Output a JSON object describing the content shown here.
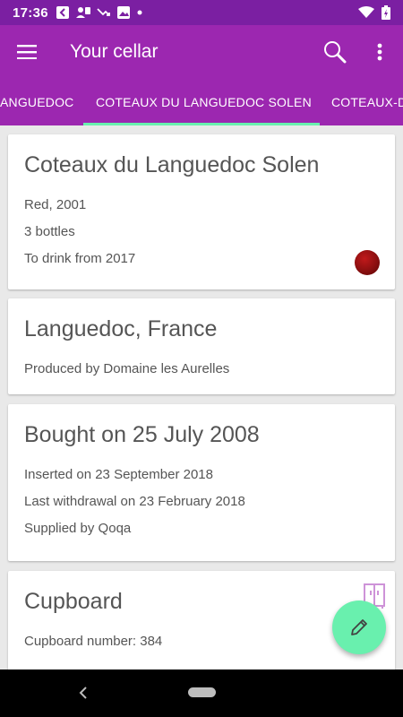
{
  "status_bar": {
    "time": "17:36"
  },
  "app_bar": {
    "title": "Your cellar"
  },
  "tabs": [
    "LANGUEDOC",
    "COTEAUX DU LANGUEDOC SOLEN",
    "COTEAUX-D"
  ],
  "wine_card": {
    "name": "Coteaux du Languedoc Solen",
    "type_year": "Red, 2001",
    "bottles": "3  bottles",
    "drink_from": "To drink from 2017",
    "wine_color": "#8b0f10"
  },
  "origin_card": {
    "region": "Languedoc, France",
    "producer": "Produced by Domaine les Aurelles"
  },
  "purchase_card": {
    "bought": "Bought on 25 July 2008",
    "inserted": "Inserted on 23 September 2018",
    "last_withdrawal": "Last withdrawal on 23 February 2018",
    "supplier": "Supplied by Qoqa"
  },
  "storage_card": {
    "title": "Cupboard",
    "number": "Cupboard number: 384"
  },
  "colors": {
    "primary": "#9c27b0",
    "primary_dark": "#7b1fa2",
    "accent": "#69f0ae"
  }
}
